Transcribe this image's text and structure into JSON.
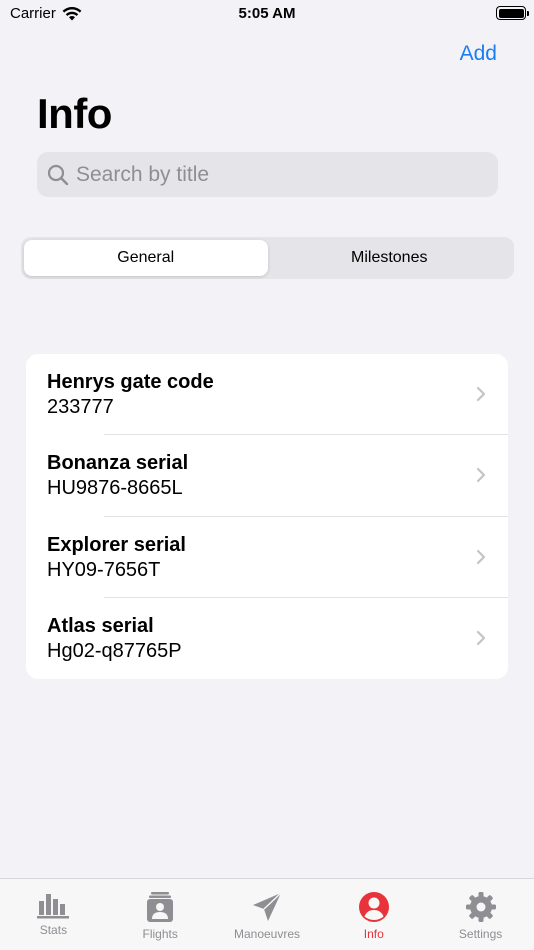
{
  "status_bar": {
    "carrier": "Carrier",
    "time": "5:05 AM"
  },
  "nav": {
    "add_label": "Add",
    "title": "Info"
  },
  "search": {
    "placeholder": "Search by title"
  },
  "segments": [
    {
      "label": "General",
      "selected": true
    },
    {
      "label": "Milestones",
      "selected": false
    }
  ],
  "items": [
    {
      "title": "Henrys gate code",
      "value": "233777"
    },
    {
      "title": "Bonanza serial",
      "value": "HU9876-8665L"
    },
    {
      "title": "Explorer serial",
      "value": "HY09-7656T"
    },
    {
      "title": "Atlas serial",
      "value": "Hg02-q87765P"
    }
  ],
  "tabs": [
    {
      "label": "Stats",
      "icon": "bar-chart-icon"
    },
    {
      "label": "Flights",
      "icon": "logbook-icon"
    },
    {
      "label": "Manoeuvres",
      "icon": "paper-plane-icon"
    },
    {
      "label": "Info",
      "icon": "person-circle-icon",
      "active": true
    },
    {
      "label": "Settings",
      "icon": "gear-icon"
    }
  ],
  "colors": {
    "accent": "#1a7ef2",
    "active_tab": "#e8333a",
    "inactive_tab": "#8e8e93",
    "background": "#f2f2f7"
  }
}
